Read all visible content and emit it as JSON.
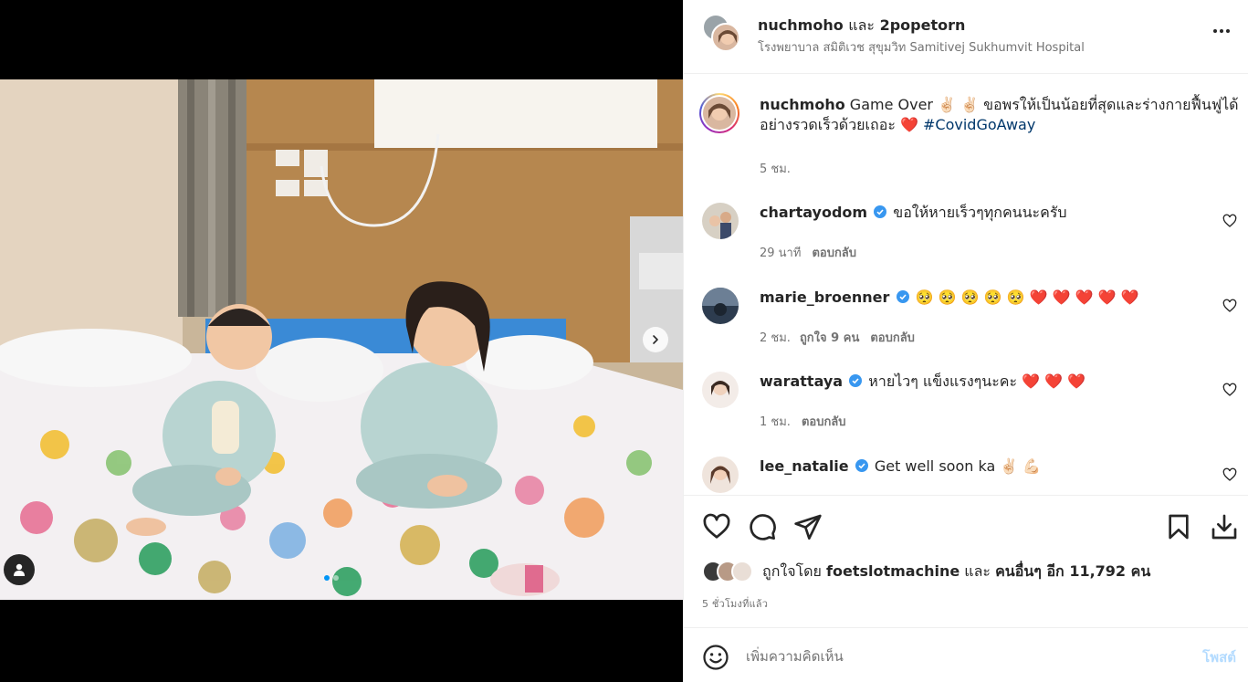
{
  "post": {
    "header": {
      "username": "nuchmoho",
      "joiner": "และ",
      "coauthor": "2popetorn",
      "location": "โรงพยาบาล สมิติเวช สุขุมวิท Samitivej Sukhumvit Hospital",
      "more_icon": "more-horizontal-icon"
    },
    "media": {
      "carousel_count": 2,
      "active_index": 0,
      "next_icon": "chevron-right-icon",
      "tag_icon": "user-tag-icon"
    },
    "caption": {
      "username": "nuchmoho",
      "text": "Game Over ✌🏻 ✌🏻  ขอพรให้เป็นน้อยที่สุดและร่างกายฟื้นฟูได้อย่างรวดเร็วด้วยเถอะ ❤️",
      "hashtag": "#CovidGoAway",
      "time": "5 ชม."
    },
    "comments": [
      {
        "username": "chartayodom",
        "verified": true,
        "text": "ขอให้หายเร็วๆทุกคนนะครับ",
        "time": "29 นาที",
        "likes": "",
        "reply": "ตอบกลับ"
      },
      {
        "username": "marie_broenner",
        "verified": true,
        "text": "🥺 🥺 🥺 🥺 🥺 ❤️ ❤️ ❤️ ❤️ ❤️",
        "time": "2 ชม.",
        "likes": "ถูกใจ 9 คน",
        "reply": "ตอบกลับ"
      },
      {
        "username": "warattaya",
        "verified": true,
        "text": "หายไวๆ แข็งแรงๆนะคะ ❤️ ❤️ ❤️",
        "time": "1 ชม.",
        "likes": "",
        "reply": "ตอบกลับ"
      },
      {
        "username": "lee_natalie",
        "verified": true,
        "text": "Get well soon ka ✌🏻 💪🏻",
        "time": "",
        "likes": "",
        "reply": ""
      }
    ],
    "actions": {
      "like_icon": "heart-icon",
      "comment_icon": "comment-icon",
      "share_icon": "send-icon",
      "save_icon": "bookmark-icon",
      "download_icon": "download-icon"
    },
    "likes": {
      "prefix": "ถูกใจโดย",
      "first_liker": "foetslotmachine",
      "joiner": "และ",
      "others": "คนอื่นๆ อีก 11,792 คน"
    },
    "posted_ago": "5 ชั่วโมงที่แล้ว",
    "add_comment": {
      "placeholder": "เพิ่มความคิดเห็น",
      "post_label": "โพสต์",
      "emoji_icon": "smiley-icon"
    }
  },
  "colors": {
    "text": "#262626",
    "secondary": "#737373",
    "link": "#00376b",
    "verified": "#3897f0",
    "post_disabled": "#b3dbff",
    "heart": "#ed4956"
  }
}
